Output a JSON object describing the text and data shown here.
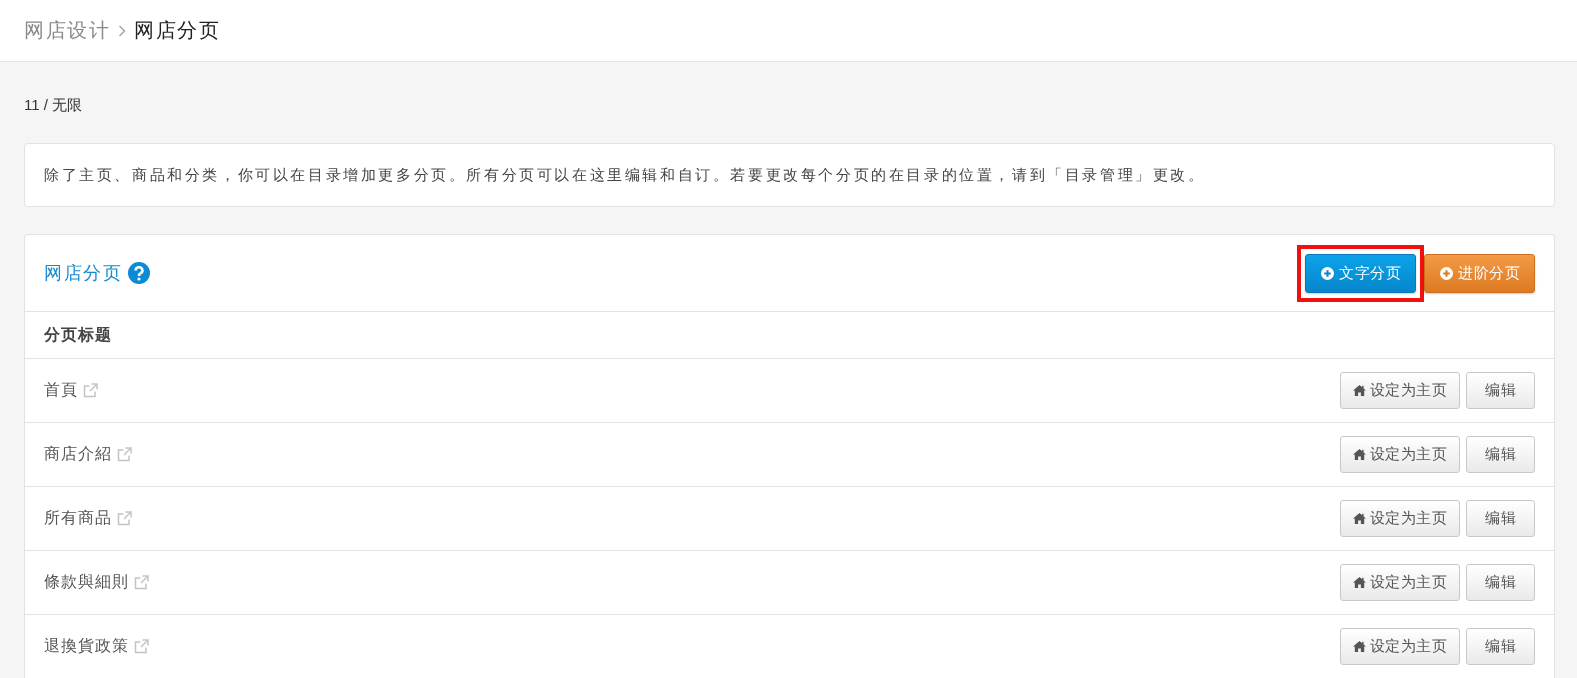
{
  "breadcrumb": [
    {
      "label": "网店设计",
      "current": false
    },
    {
      "label": "网店分页",
      "current": true
    }
  ],
  "usage": "11 / 无限",
  "notice": "除了主页、商品和分类，你可以在目录增加更多分页。所有分页可以在这里编辑和自订。若要更改每个分页的在目录的位置，请到「目录管理」更改。",
  "panel": {
    "title": "网店分页",
    "actions": [
      {
        "label": "文字分页",
        "kind": "primary",
        "highlighted": true
      },
      {
        "label": "进阶分页",
        "kind": "warning",
        "highlighted": false
      }
    ],
    "columns": [
      "分页标题"
    ],
    "rows": [
      {
        "title": "首頁",
        "actions": [
          {
            "kind": "set-home",
            "label": "设定为主页"
          },
          {
            "kind": "edit",
            "label": "编辑"
          }
        ]
      },
      {
        "title": "商店介紹",
        "actions": [
          {
            "kind": "set-home",
            "label": "设定为主页"
          },
          {
            "kind": "edit",
            "label": "编辑"
          }
        ]
      },
      {
        "title": "所有商品",
        "actions": [
          {
            "kind": "set-home",
            "label": "设定为主页"
          },
          {
            "kind": "edit",
            "label": "编辑"
          }
        ]
      },
      {
        "title": "條款與細則",
        "actions": [
          {
            "kind": "set-home",
            "label": "设定为主页"
          },
          {
            "kind": "edit",
            "label": "编辑"
          }
        ]
      },
      {
        "title": "退換貨政策",
        "actions": [
          {
            "kind": "set-home",
            "label": "设定为主页"
          },
          {
            "kind": "edit",
            "label": "编辑"
          }
        ]
      }
    ]
  }
}
